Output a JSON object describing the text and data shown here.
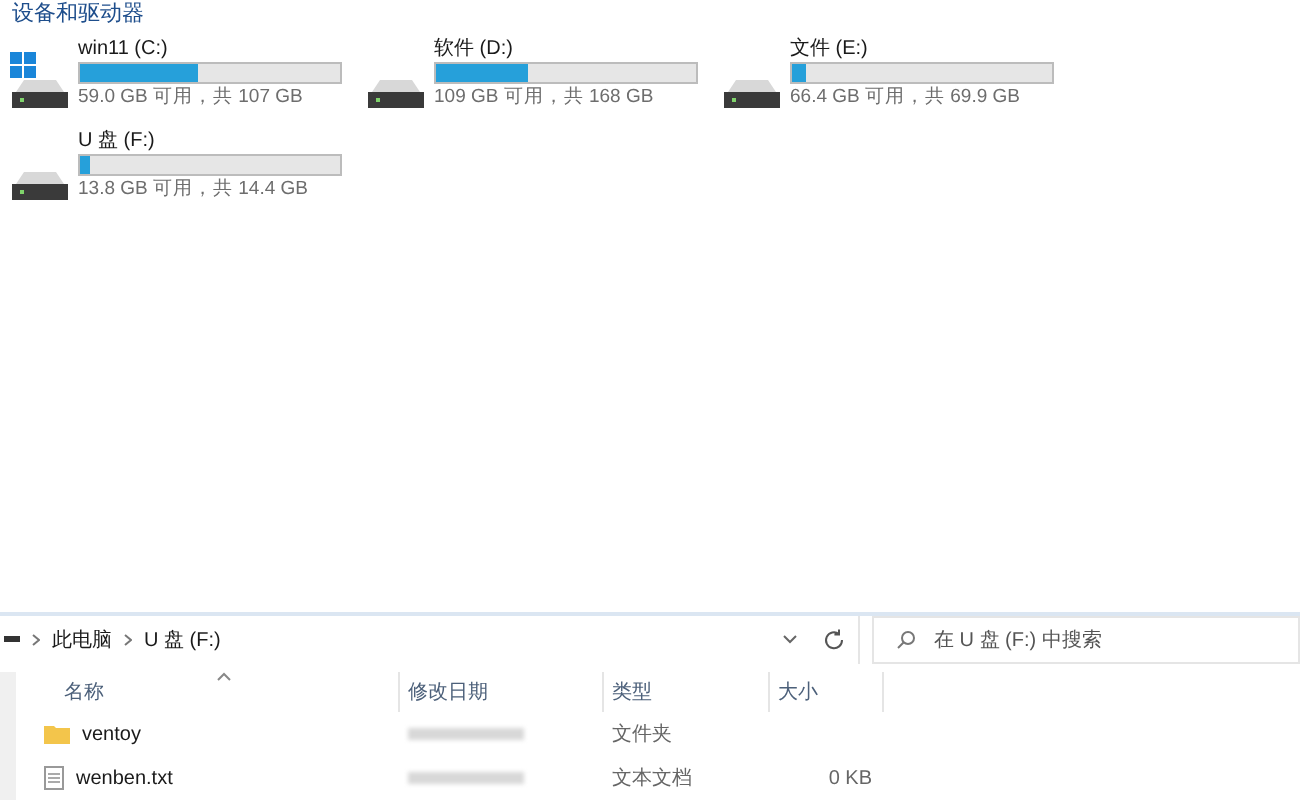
{
  "drives_section": {
    "title": "设备和驱动器",
    "drives": [
      {
        "name": "win11 (C:)",
        "kind": "system",
        "level": 0.45,
        "reading": "59.0 GB 可用，共 107 GB"
      },
      {
        "name": "软件 (D:)",
        "kind": "disk",
        "level": 0.35,
        "reading": "109 GB 可用，共 168 GB"
      },
      {
        "name": "文件 (E:)",
        "kind": "disk",
        "level": 0.05,
        "reading": "66.4 GB 可用，共 69.9 GB"
      },
      {
        "name": "U 盘 (F:)",
        "kind": "disk",
        "level": 0.04,
        "reading": "13.8 GB 可用，共 14.4 GB"
      }
    ]
  },
  "address_bar": {
    "path": [
      "此电脑",
      "U 盘 (F:)"
    ]
  },
  "search": {
    "placeholder": "在 U 盘 (F:) 中搜索"
  },
  "table": {
    "columns": [
      "名称",
      "修改日期",
      "类型",
      "大小"
    ],
    "rows": [
      {
        "kind": "folder",
        "name": "ventoy",
        "type": "文件夹",
        "size": ""
      },
      {
        "kind": "file",
        "name": "wenben.txt",
        "type": "文本文档",
        "size": "0 KB"
      }
    ]
  }
}
